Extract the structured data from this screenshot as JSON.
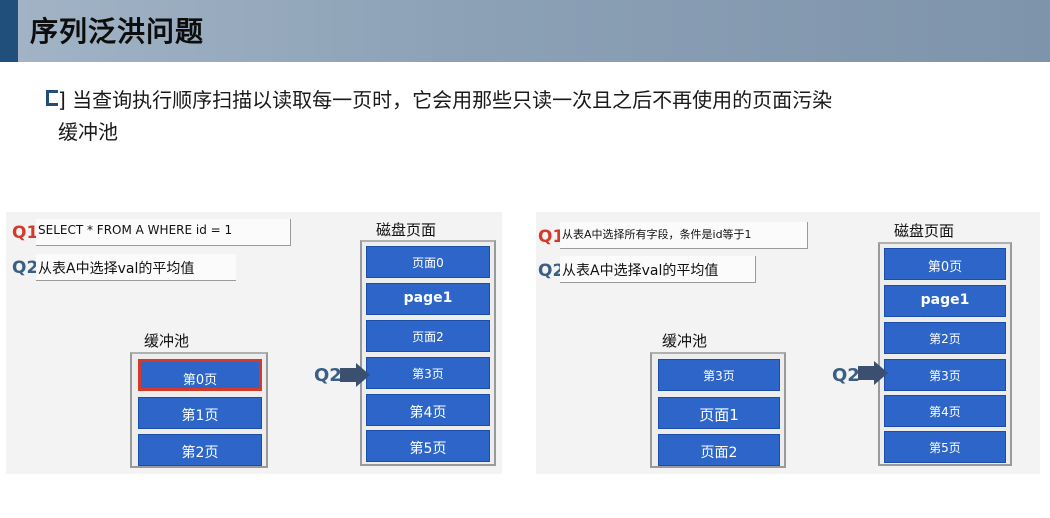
{
  "title": "序列泛洪问题",
  "bullet": {
    "line1": "] 当查询执行顺序扫描以读取每一页时，它会用那些只读一次且之后不再使用的页面污染",
    "line2": "缓冲池"
  },
  "left": {
    "q1_label": "Q1",
    "q1_text": "SELECT * FROM A WHERE id = 1",
    "q2_label": "Q2",
    "q2_text": "从表A中选择val的平均值",
    "buffer_label": "缓冲池",
    "buffer_pages": [
      "第0页",
      "第1页",
      "第2页"
    ],
    "disk_label": "磁盘页面",
    "disk_pages": [
      "页面0",
      "page1",
      "页面2",
      "第3页",
      "第4页",
      "第5页"
    ],
    "arrow_label": "Q2"
  },
  "right": {
    "q1_label": "Q1",
    "q1_text": "从表A中选择所有字段，条件是id等于1",
    "q2_label": "Q2",
    "q2_text": "从表A中选择val的平均值",
    "buffer_label": "缓冲池",
    "buffer_pages": [
      "第3页",
      "页面1",
      "页面2"
    ],
    "disk_label": "磁盘页面",
    "disk_pages": [
      "第0页",
      "page1",
      "第2页",
      "第3页",
      "第4页",
      "第5页"
    ],
    "arrow_label": "Q2"
  },
  "colors": {
    "page_block": "#2d66c8",
    "q1_red": "#d23a2a",
    "q2_blue": "#3a5f86",
    "active_border": "#d23a2a",
    "title_accent": "#1f4f7a"
  }
}
